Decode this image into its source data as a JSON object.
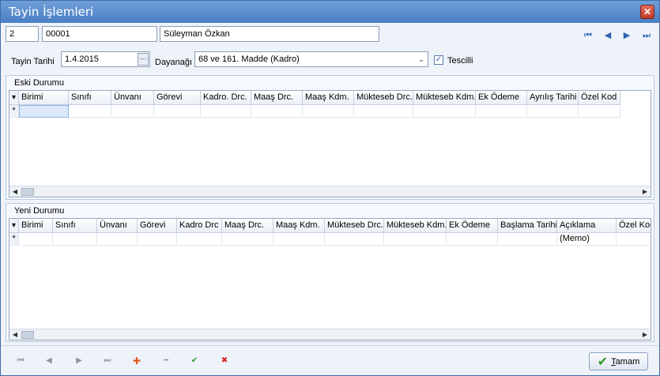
{
  "window": {
    "title": "Tayin İşlemleri",
    "close_symbol": "✕"
  },
  "record": {
    "sira": "2",
    "sicil": "00001",
    "ad_soyad": "Süleyman Özkan"
  },
  "nav": {
    "first": "⏮",
    "prev": "◀",
    "next": "▶",
    "last": "⏭"
  },
  "form": {
    "tayin_tarihi_label": "Tayin Tarihi",
    "tayin_tarihi": "1.4.2015",
    "ellipsis": "···",
    "dayanagi_label": "Dayanağı",
    "dayanagi": "68 ve 161. Madde (Kadro)",
    "combo_arrow": "⌄",
    "tescilli_label": "Tescilli",
    "tescilli_check": "✓"
  },
  "eski": {
    "title": "Eski Durumu",
    "indicator": "▾",
    "columns": [
      "Birimi",
      "Sınıfı",
      "Ünvanı",
      "Görevi",
      "Kadro. Drc.",
      "Maaş Drc.",
      "Maaş Kdm.",
      "Mükteseb Drc.",
      "Mükteseb Kdm.",
      "Ek Ödeme",
      "Ayrılış Tarihi",
      "Özel Kod"
    ],
    "new_row_marker": "*"
  },
  "yeni": {
    "title": "Yeni Durumu",
    "indicator": "▾",
    "columns": [
      "Birimi",
      "Sınıfı",
      "Ünvanı",
      "Görevi",
      "Kadro Drc",
      "Maaş Drc.",
      "Maaş Kdm.",
      "Mükteseb Drc.",
      "Mükteseb Kdm.",
      "Ek Ödeme",
      "Başlama Tarihi",
      "Açıklama",
      "Özel Kod"
    ],
    "new_row_marker": "*",
    "memo": "(Memo)"
  },
  "scroll": {
    "left": "◀",
    "right": "▶"
  },
  "bottom": {
    "first": "⏮",
    "prev": "◀",
    "next": "▶",
    "last": "⏭",
    "add": "✚",
    "remove": "━",
    "confirm": "✔",
    "cancel": "✖",
    "ok_check": "✔",
    "ok_mnemonic": "T",
    "ok_rest": "amam"
  },
  "colors": {
    "accent": "#2e63b3",
    "add": "#e0581f",
    "confirm": "#2a9a2a",
    "cancel": "#d42020"
  }
}
